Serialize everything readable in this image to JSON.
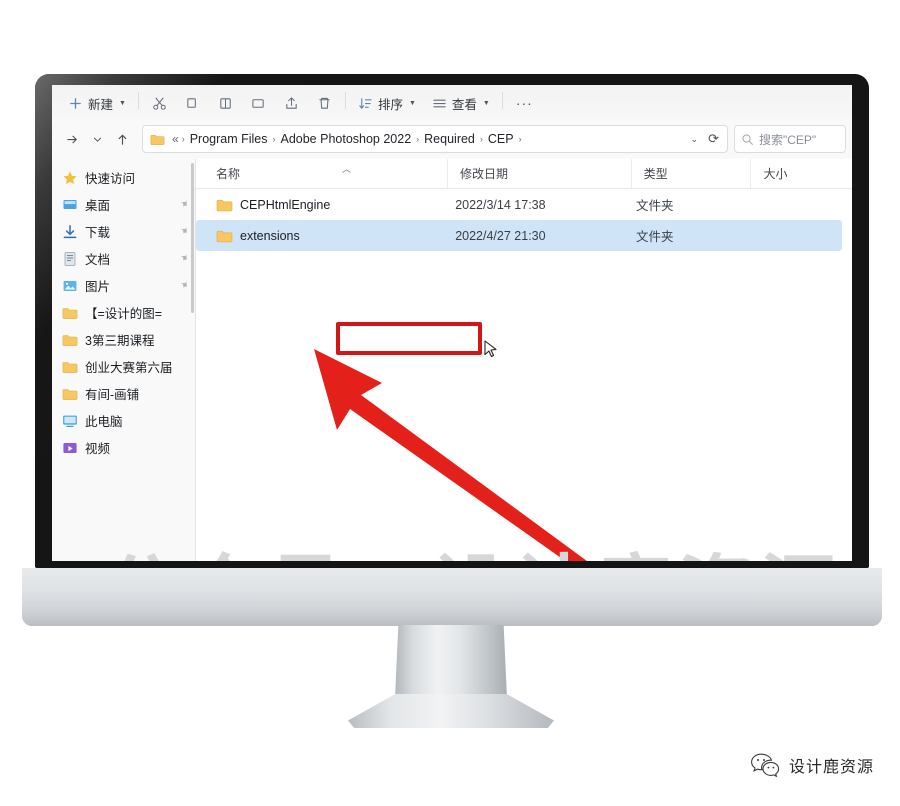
{
  "toolbar": {
    "new_label": "新建",
    "sort_label": "排序",
    "view_label": "查看",
    "more_label": "···",
    "icons": [
      "new-icon",
      "cut-icon",
      "copy-icon",
      "paste-icon",
      "rename-icon",
      "share-icon",
      "delete-icon",
      "sort-icon",
      "view-icon",
      "more-icon"
    ]
  },
  "navbar": {
    "forward_icon": "arrow-right-icon",
    "history_icon": "chevron-down-icon",
    "up_icon": "arrow-up-icon",
    "breadcrumb_prefix": "«",
    "breadcrumb": [
      "Program Files",
      "Adobe Photoshop 2022",
      "Required",
      "CEP"
    ],
    "separator": "›",
    "dropdown_icon": "chevron-down-icon",
    "refresh_icon": "refresh-icon",
    "search_icon": "search-icon",
    "search_placeholder": "搜索\"CEP\""
  },
  "sidebar": {
    "items": [
      {
        "label": "快速访问",
        "icon": "star-icon",
        "pinned": false
      },
      {
        "label": "桌面",
        "icon": "desktop-icon",
        "pinned": true
      },
      {
        "label": "下载",
        "icon": "download-icon",
        "pinned": true
      },
      {
        "label": "文档",
        "icon": "document-icon",
        "pinned": true
      },
      {
        "label": "图片",
        "icon": "pictures-icon",
        "pinned": true
      },
      {
        "label": "【=设计的图=",
        "icon": "folder-icon",
        "pinned": false
      },
      {
        "label": "3第三期课程",
        "icon": "folder-icon",
        "pinned": false
      },
      {
        "label": "创业大赛第六届",
        "icon": "folder-icon",
        "pinned": false
      },
      {
        "label": "有间-画铺",
        "icon": "folder-icon",
        "pinned": false
      },
      {
        "label": "此电脑",
        "icon": "this-pc-icon",
        "pinned": false
      },
      {
        "label": "视频",
        "icon": "video-icon",
        "pinned": false
      }
    ]
  },
  "filelist": {
    "columns": [
      "名称",
      "修改日期",
      "类型",
      "大小"
    ],
    "sort_column": "名称",
    "sort_direction": "ascending",
    "rows": [
      {
        "name": "CEPHtmlEngine",
        "date": "2022/3/14 17:38",
        "type": "文件夹",
        "size": "",
        "selected": false
      },
      {
        "name": "extensions",
        "date": "2022/4/27 21:30",
        "type": "文件夹",
        "size": "",
        "selected": true
      }
    ]
  },
  "annotations": {
    "highlight_color": "#d01616",
    "highlight_target": "extensions",
    "arrow": "red-arrow-pointing-to-extensions",
    "cursor": "mouse-pointer"
  },
  "watermark": {
    "main": "公众号：设计鹿资源",
    "brand_name": "设计鹿资源",
    "brand_icon": "wechat-icon"
  },
  "colors": {
    "selection": "#cfe4f7",
    "annotation": "#d01616",
    "folder": "#f6c762",
    "bezel": "#151515"
  }
}
